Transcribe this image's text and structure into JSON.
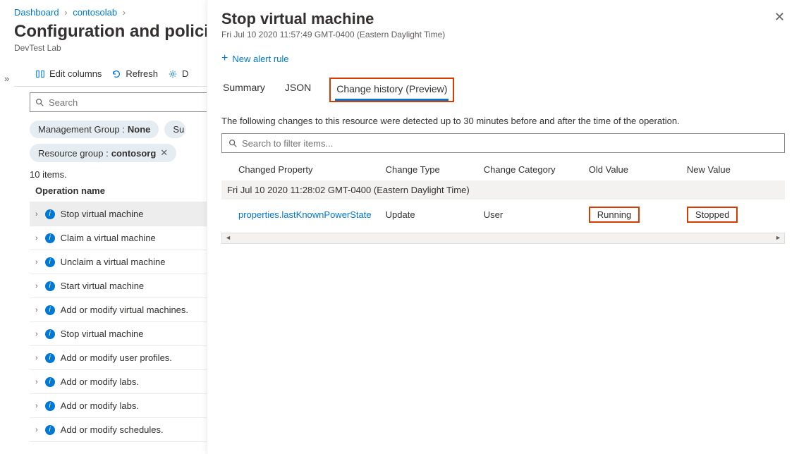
{
  "breadcrumb": {
    "dashboard": "Dashboard",
    "lab": "contosolab"
  },
  "page": {
    "title": "Configuration and policies",
    "subtitle": "DevTest Lab"
  },
  "toolbar": {
    "edit_columns": "Edit columns",
    "refresh": "Refresh",
    "more": "D"
  },
  "search": {
    "placeholder": "Search"
  },
  "filters": {
    "mgmt_label": "Management Group : ",
    "mgmt_value": "None",
    "sub_label": "Su",
    "rg_label": "Resource group : ",
    "rg_value": "contosorg"
  },
  "items_count": "10 items.",
  "list_header": "Operation name",
  "operations": [
    "Stop virtual machine",
    "Claim a virtual machine",
    "Unclaim a virtual machine",
    "Start virtual machine",
    "Add or modify virtual machines.",
    "Stop virtual machine",
    "Add or modify user profiles.",
    "Add or modify labs.",
    "Add or modify labs.",
    "Add or modify schedules."
  ],
  "panel": {
    "title": "Stop virtual machine",
    "timestamp": "Fri Jul 10 2020 11:57:49 GMT-0400 (Eastern Daylight Time)",
    "new_alert": "New alert rule",
    "tabs": {
      "summary": "Summary",
      "json": "JSON",
      "change": "Change history (Preview)"
    },
    "desc": "The following changes to this resource were detected up to 30 minutes before and after the time of the operation.",
    "filter_placeholder": "Search to filter items...",
    "columns": {
      "prop": "Changed Property",
      "type": "Change Type",
      "cat": "Change Category",
      "old": "Old Value",
      "new": "New Value"
    },
    "group": "Fri Jul 10 2020 11:28:02 GMT-0400 (Eastern Daylight Time)",
    "row": {
      "prop": "properties.lastKnownPowerState",
      "type": "Update",
      "cat": "User",
      "old": "Running",
      "new": "Stopped"
    }
  }
}
